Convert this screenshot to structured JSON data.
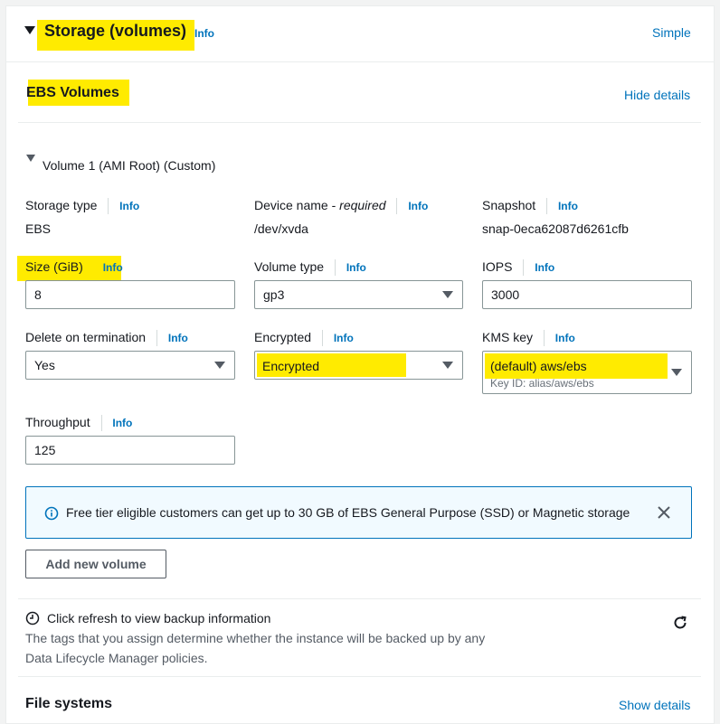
{
  "header": {
    "title": "Storage (volumes)",
    "info": "Info",
    "simple_link": "Simple"
  },
  "ebs": {
    "title": "EBS Volumes",
    "hide_details": "Hide details",
    "volume_title": "Volume 1 (AMI Root) (Custom)"
  },
  "fields": {
    "storage_type_label": "Storage type",
    "storage_type_value": "EBS",
    "device_name_label": "Device name - ",
    "device_name_required": "required",
    "device_name_value": "/dev/xvda",
    "snapshot_label": "Snapshot",
    "snapshot_value": "snap-0eca62087d6261cfb",
    "size_label": "Size (GiB)",
    "size_value": "8",
    "volume_type_label": "Volume type",
    "volume_type_value": "gp3",
    "iops_label": "IOPS",
    "iops_value": "3000",
    "delete_label": "Delete on termination",
    "delete_value": "Yes",
    "encrypted_label": "Encrypted",
    "encrypted_value": "Encrypted",
    "kms_label": "KMS key",
    "kms_value": "(default) aws/ebs",
    "kms_key_id": "Key ID: alias/aws/ebs",
    "throughput_label": "Throughput",
    "throughput_value": "125",
    "info": "Info"
  },
  "alert": {
    "text": "Free tier eligible customers can get up to 30 GB of EBS General Purpose (SSD) or Magnetic storage"
  },
  "add_volume_button": "Add new volume",
  "backup": {
    "title": "Click refresh to view backup information",
    "description_line1": "The tags that you assign determine whether the instance will be backed up by any",
    "description_line2": "Data Lifecycle Manager policies."
  },
  "file_systems": {
    "title": "File systems",
    "show_details": "Show details"
  },
  "colors": {
    "highlight": "#ffeb00",
    "link": "#0073bb",
    "alert_border": "#0073bb",
    "alert_bg": "#f1faff"
  }
}
